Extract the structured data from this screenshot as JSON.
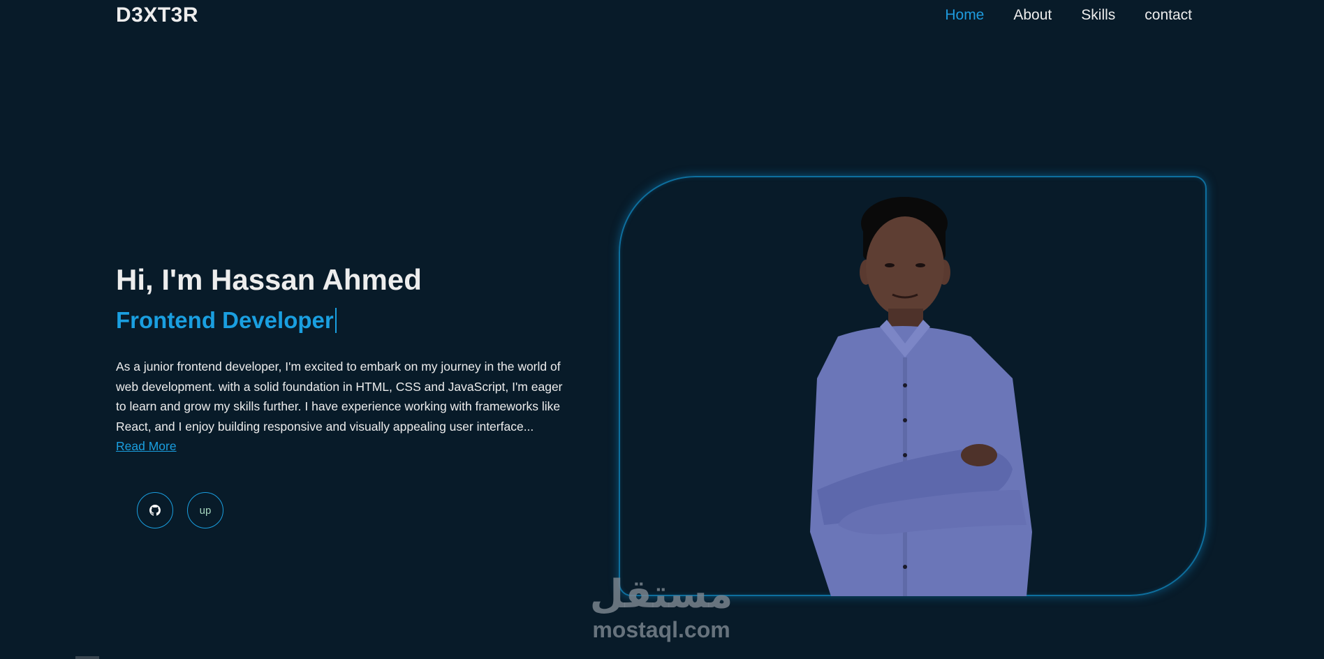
{
  "header": {
    "logo": "D3XT3R",
    "nav": [
      {
        "label": "Home",
        "active": true
      },
      {
        "label": "About",
        "active": false
      },
      {
        "label": "Skills",
        "active": false
      },
      {
        "label": "contact",
        "active": false
      }
    ]
  },
  "hero": {
    "title": "Hi, I'm Hassan Ahmed",
    "role": "Frontend Developer",
    "description": "As a junior frontend developer, I'm excited to embark on my journey in the world of web development. with a solid foundation in HTML, CSS and JavaScript, I'm eager to learn and grow my skills further. I have experience working with frameworks like React, and I enjoy building responsive and visually appealing user interface...",
    "read_more": "Read More"
  },
  "social": {
    "github_icon": "github-icon",
    "up_label": "up"
  },
  "watermark": {
    "arabic": "مستقل",
    "latin": "mostaql.com"
  },
  "colors": {
    "background": "#081b29",
    "accent": "#1a9fe0",
    "text": "#ededed"
  }
}
